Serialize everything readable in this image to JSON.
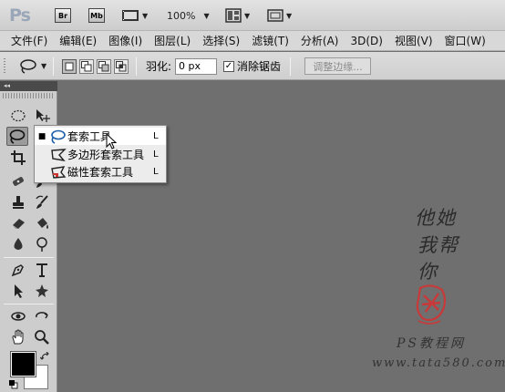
{
  "appbar": {
    "logo": "Ps",
    "bridge_badge": "Br",
    "mini_bridge_badge": "Mb",
    "zoom_value": "100%"
  },
  "menu": [
    "文件(F)",
    "编辑(E)",
    "图像(I)",
    "图层(L)",
    "选择(S)",
    "滤镜(T)",
    "分析(A)",
    "3D(D)",
    "视图(V)",
    "窗口(W)"
  ],
  "options": {
    "feather_label": "羽化:",
    "feather_value": "0 px",
    "antialias_label": "消除锯齿",
    "antialias_checked": true,
    "refine_edge_label": "调整边缘..."
  },
  "toolbox": {
    "collapse_glyph": "◂◂"
  },
  "flyout": {
    "items": [
      {
        "label": "套索工具",
        "shortcut": "L",
        "icon": "lasso-icon",
        "current": true
      },
      {
        "label": "多边形套索工具",
        "shortcut": "L",
        "icon": "polygonal-lasso-icon",
        "current": false
      },
      {
        "label": "磁性套索工具",
        "shortcut": "L",
        "icon": "magnetic-lasso-icon",
        "current": false
      }
    ],
    "bullet": "■"
  },
  "watermark": {
    "signature_lines": [
      "他她",
      "我帮",
      "你"
    ],
    "caption": "PS教程网",
    "url": "www.tata580.com",
    "seal_color": "#c8393a"
  },
  "colors": {
    "canvas": "#6f6f6f",
    "panel": "#cdcdcd",
    "foreground": "#000000",
    "background": "#ffffff"
  }
}
